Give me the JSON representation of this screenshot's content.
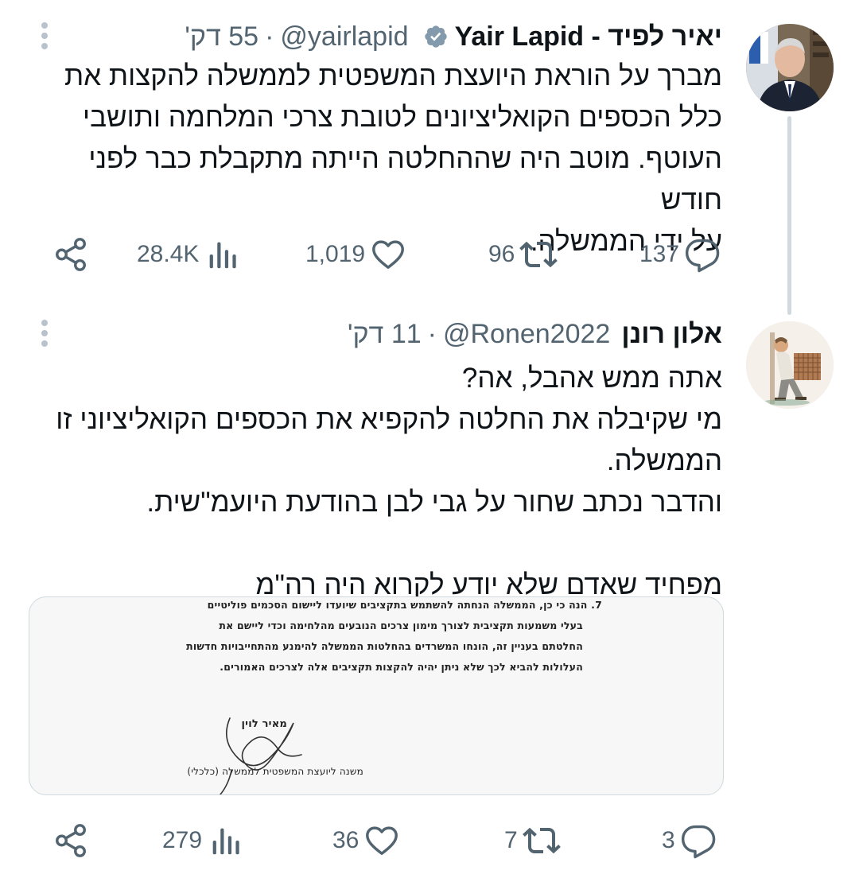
{
  "tweets": [
    {
      "display_name": "יאיר לפיד - Yair Lapid",
      "handle": "@yairlapid",
      "time": "55 דק'",
      "separator": "·",
      "verified": true,
      "avatar_icon": "user-avatar-photo",
      "body_lines": [
        "מברך על הוראת היועצת המשפטית לממשלה להקצות את",
        "כלל הכספים הקואליציונים לטובת צרכי המלחמה ותושבי",
        "העוטף. מוטב היה שההחלטה הייתה מתקבלת כבר לפני חודש",
        "על ידי הממשלה."
      ],
      "actions": {
        "reply_count": "137",
        "retweet_count": "96",
        "like_count": "1,019",
        "views_count": "28.4K"
      }
    },
    {
      "display_name": "אלון רונן",
      "handle": "@Ronen2022",
      "time": "11 דק'",
      "separator": "·",
      "verified": false,
      "avatar_icon": "illustrated-avatar",
      "body_lines": [
        "אתה ממש אהבל, אה?",
        "מי שקיבלה את החלטה להקפיא את הכספים הקואליציוני זו",
        "הממשלה.",
        "והדבר נכתב שחור על גבי לבן בהודעת היועמ\"שית.",
        "",
        "מפחיד שאדם שלא יודע לקרוא היה רה\"מ"
      ],
      "media": {
        "document_lines": [
          "7.   הנה כי כן, הממשלה הנחתה להשתמש בתקציבים שיועדו ליישום הסכמים פוליטיים",
          "בעלי משמעות תקציבית לצורך מימון צרכים הנובעים מהלחימה וכדי ליישם את",
          "החלטתם בעניין זה, הונחו המשרדים בהחלטות הממשלה להימנע מהתחייבויות חדשות",
          "העלולות להביא לכך שלא ניתן יהיה להקצות תקציבים אלה לצרכים האמורים."
        ],
        "signer_name": "מאיר לוין",
        "signer_title": "משנה ליועצת המשפטית לממשלה (כלכלי)"
      },
      "actions": {
        "reply_count": "3",
        "retweet_count": "7",
        "like_count": "36",
        "views_count": "279"
      }
    }
  ],
  "colors": {
    "text_primary": "#0f1419",
    "text_secondary": "#536471",
    "verified_badge": "#829aab",
    "thread_line": "#cfd9de",
    "border": "#cfd9de"
  }
}
